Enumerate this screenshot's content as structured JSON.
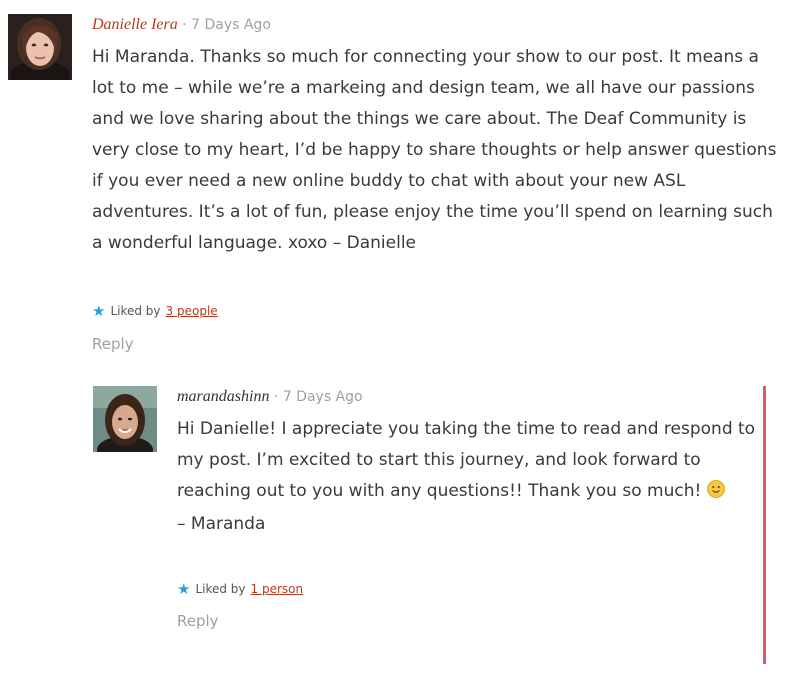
{
  "comments": [
    {
      "author": "Danielle Iera",
      "separator": "·",
      "timestamp": "7 Days Ago",
      "text": "Hi Maranda. Thanks so much for connecting your show to our post. It means a lot to me – while we’re a markeing and design team, we all have our passions and we love sharing about the things we care about. The Deaf Community is very close to my heart, I’d be happy to share thoughts or help answer questions if you ever need a new online buddy to chat with about your new ASL adventures. It’s a lot of fun, please enjoy the time you’ll spend on learning such a wonderful language. xoxo – Danielle",
      "liked_by_label": "Liked by",
      "liked_by_link": "3 people",
      "reply_label": "Reply"
    },
    {
      "author": "marandashinn",
      "separator": "·",
      "timestamp": "7 Days Ago",
      "text_line1": "Hi Danielle! I appreciate you taking the time to read and respond to my post. I’m excited to start this journey, and look forward to reaching out to you with any questions!! Thank you so much!",
      "text_line2": "– Maranda",
      "emoji": "smiley-emoji",
      "liked_by_label": "Liked by",
      "liked_by_link": "1 person",
      "reply_label": "Reply"
    }
  ],
  "colors": {
    "author_link": "#b83a1e",
    "star": "#2ba0d4",
    "thread_bar": "#e05a63",
    "muted": "#a0a0a0"
  },
  "icons": {
    "like": "star-icon"
  }
}
